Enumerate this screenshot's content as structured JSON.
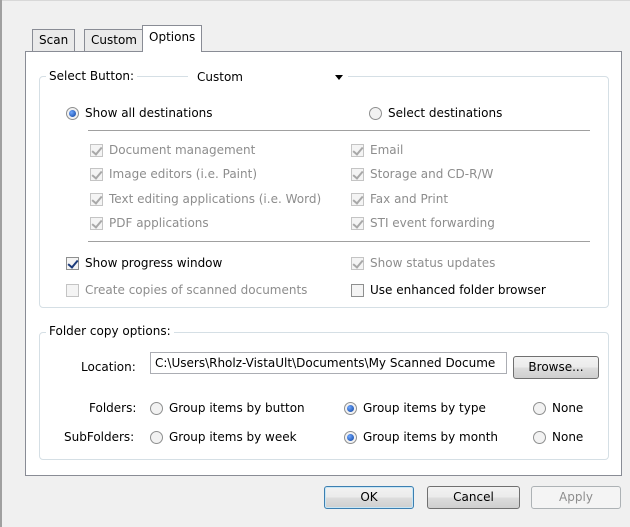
{
  "tabs": [
    {
      "label": "Scan"
    },
    {
      "label": "Custom"
    },
    {
      "label": "Options"
    }
  ],
  "select_button": {
    "label": "Select Button:",
    "value": "Custom"
  },
  "destinations": {
    "show_all_label": "Show all destinations",
    "select_label": "Select destinations",
    "left_items": [
      "Document management",
      "Image editors (i.e. Paint)",
      "Text editing applications (i.e. Word)",
      "PDF applications"
    ],
    "right_items": [
      "Email",
      "Storage and CD-R/W",
      "Fax and Print",
      "STI event forwarding"
    ]
  },
  "options": {
    "show_progress": "Show progress window",
    "show_status": "Show status updates",
    "create_copies": "Create copies of scanned documents",
    "enhanced_browser": "Use enhanced folder browser"
  },
  "folder_copy": {
    "title": "Folder copy options:",
    "location_label": "Location:",
    "location_value": "C:\\Users\\Rholz-VistaUlt\\Documents\\My Scanned Docume",
    "browse_label": "Browse...",
    "folders_label": "Folders:",
    "folders_options": [
      "Group items by button",
      "Group items by type",
      "None"
    ],
    "subfolders_label": "SubFolders:",
    "subfolders_options": [
      "Group items by week",
      "Group items by month",
      "None"
    ]
  },
  "footer": {
    "ok": "OK",
    "cancel": "Cancel",
    "apply": "Apply"
  }
}
